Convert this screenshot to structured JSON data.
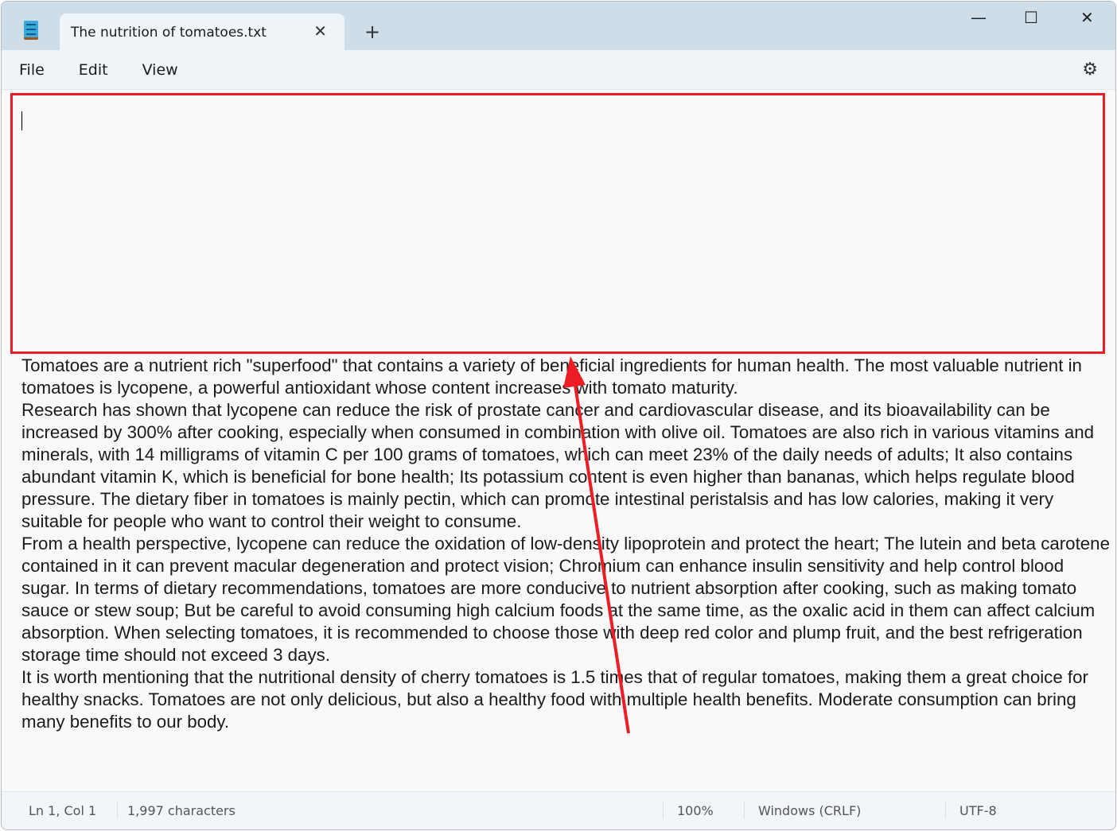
{
  "window": {
    "tab_title": "The nutrition of tomatoes.txt",
    "new_tab": "+",
    "minimize": "—",
    "maximize": "☐",
    "close": "✕"
  },
  "menu": {
    "file": "File",
    "edit": "Edit",
    "view": "View"
  },
  "document": {
    "paragraphs": [
      "Tomatoes are a nutrient rich \"superfood\" that contains a variety of beneficial ingredients for human health. The most valuable nutrient in tomatoes is lycopene, a powerful antioxidant whose content increases with tomato maturity.",
      "Research has shown that lycopene can reduce the risk of prostate cancer and cardiovascular disease, and its bioavailability can be increased by 300% after cooking, especially when consumed in combination with olive oil. Tomatoes are also rich in various vitamins and minerals, with 14 milligrams of vitamin C per 100 grams of tomatoes, which can meet 23% of the daily needs of adults; It also contains abundant vitamin K, which is beneficial for bone health; Its potassium content is even higher than bananas, which helps regulate blood pressure. The dietary fiber in tomatoes is mainly pectin, which can promote intestinal peristalsis and has low calories, making it very suitable for people who want to control their weight to consume.",
      "From a health perspective, lycopene can reduce the oxidation of low-density lipoprotein and protect the heart; The lutein and beta carotene contained in it can prevent macular degeneration and protect vision; Chromium can enhance insulin sensitivity and help control blood sugar. In terms of dietary recommendations, tomatoes are more conducive to nutrient absorption after cooking, such as making tomato sauce or stew soup; But be careful to avoid consuming high calcium foods at the same time, as the oxalic acid in them can affect calcium absorption. When selecting tomatoes, it is recommended to choose those with deep red color and plump fruit, and the best refrigeration storage time should not exceed 3 days.",
      "It is worth mentioning that the nutritional density of cherry tomatoes is 1.5 times that of regular tomatoes, making them a great choice for healthy snacks. Tomatoes are not only delicious, but also a healthy food with multiple health benefits. Moderate consumption can bring many benefits to our body."
    ]
  },
  "status": {
    "position": "Ln 1, Col 1",
    "characters": "1,997 characters",
    "zoom": "100%",
    "line_ending": "Windows (CRLF)",
    "encoding": "UTF-8"
  },
  "colors": {
    "highlight": "#ee1c24"
  }
}
